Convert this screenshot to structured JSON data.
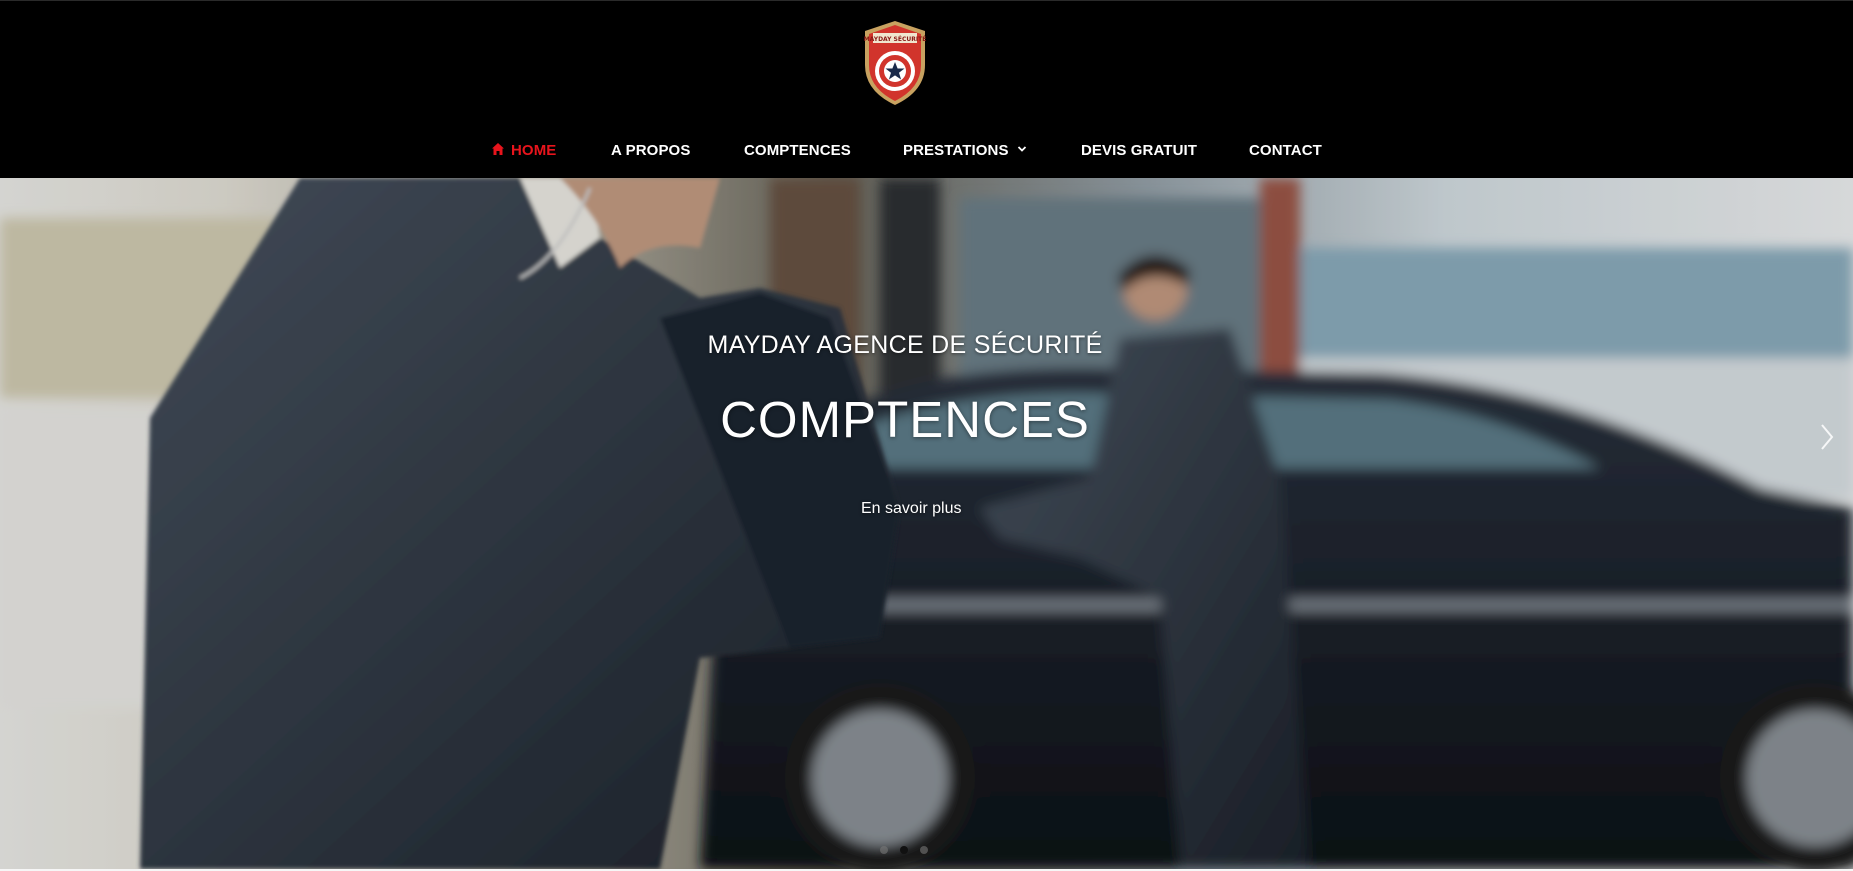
{
  "brand": {
    "logo_alt": "MAYDAY SÉCURITÉ",
    "logo_icon": "shield-star-logo",
    "accent_color": "#e8141c"
  },
  "nav": {
    "items": [
      {
        "label": "HOME",
        "icon": "home-icon",
        "active": true
      },
      {
        "label": "A PROPOS"
      },
      {
        "label": "COMPTENCES"
      },
      {
        "label": "PRESTATIONS",
        "has_dropdown": true
      },
      {
        "label": "DEVIS GRATUIT"
      },
      {
        "label": "CONTACT"
      }
    ]
  },
  "hero": {
    "kicker": "MAYDAY AGENCE DE SÉCURITÉ",
    "title": "COMPTENCES",
    "cta": "En savoir plus",
    "slide_count": 3,
    "active_slide": 2
  }
}
